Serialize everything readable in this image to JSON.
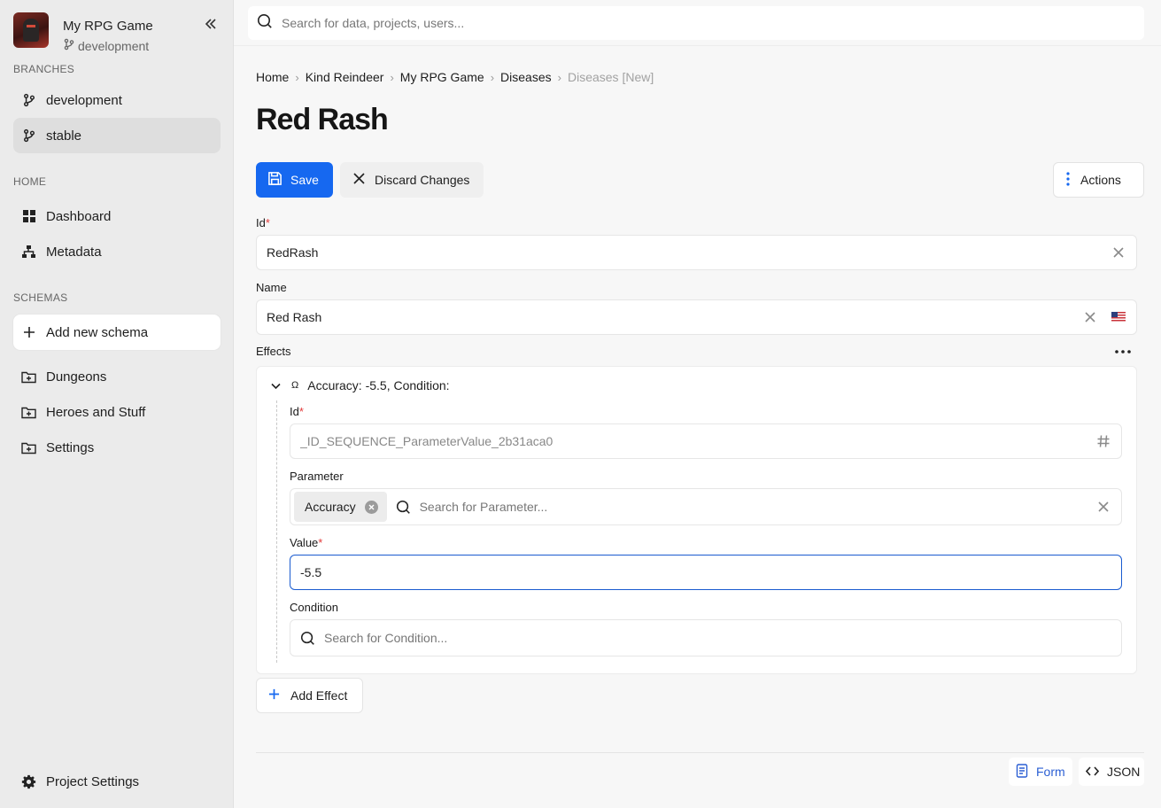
{
  "project": {
    "name": "My RPG Game",
    "branch": "development"
  },
  "sidebar": {
    "branches_label": "BRANCHES",
    "branches": [
      {
        "label": "development"
      },
      {
        "label": "stable"
      }
    ],
    "home_label": "HOME",
    "home_items": [
      {
        "label": "Dashboard",
        "icon": "dashboard-icon"
      },
      {
        "label": "Metadata",
        "icon": "hierarchy-icon"
      }
    ],
    "schemas_label": "SCHEMAS",
    "add_schema": "Add new schema",
    "schemas": [
      {
        "label": "Dungeons"
      },
      {
        "label": "Heroes and Stuff"
      },
      {
        "label": "Settings"
      }
    ],
    "project_settings": "Project Settings"
  },
  "search": {
    "placeholder": "Search for data, projects, users..."
  },
  "breadcrumb": [
    "Home",
    "Kind Reindeer",
    "My RPG Game",
    "Diseases",
    "Diseases [New]"
  ],
  "page": {
    "title": "Red Rash"
  },
  "toolbar": {
    "save": "Save",
    "discard": "Discard Changes",
    "actions": "Actions"
  },
  "form": {
    "id_label": "Id",
    "id_value": "RedRash",
    "name_label": "Name",
    "name_value": "Red Rash",
    "effects_label": "Effects",
    "effect": {
      "summary": "Accuracy: -5.5, Condition:",
      "omega": "Ω",
      "id_label": "Id",
      "id_value": "_ID_SEQUENCE_ParameterValue_2b31aca0",
      "parameter_label": "Parameter",
      "parameter_chip": "Accuracy",
      "parameter_placeholder": "Search for Parameter...",
      "value_label": "Value",
      "value": "-5.5",
      "condition_label": "Condition",
      "condition_placeholder": "Search for Condition..."
    },
    "add_effect": "Add Effect",
    "required_mark": "*"
  },
  "view_toggle": {
    "form": "Form",
    "json": "JSON"
  },
  "colors": {
    "primary": "#1668f0",
    "required": "#e33b3b",
    "form_link": "#2b5fd4"
  }
}
